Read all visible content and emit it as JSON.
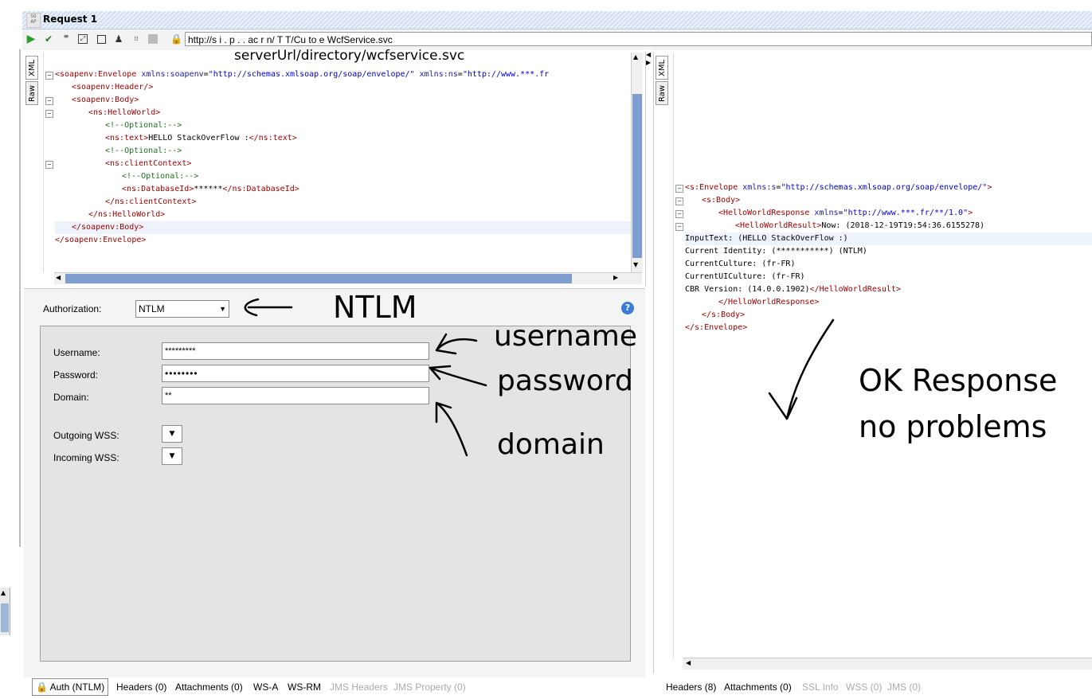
{
  "window": {
    "icon_text": "SO AP",
    "title": "Request 1"
  },
  "toolbar": {
    "url": "http://s      i .  p  .  . ac  r    n/    T  T/Cu  to   e WcfService.svc",
    "icons": [
      "run-icon",
      "validate-icon",
      "sub-icon",
      "expand-icon",
      "square-icon",
      "user-icon",
      "tests-icon",
      "stop-icon",
      "lock-icon"
    ]
  },
  "request": {
    "view_tabs": [
      "XML",
      "Raw"
    ],
    "xml_lines": [
      {
        "indent": 0,
        "fold": true,
        "parts": [
          [
            "tag",
            "<soapenv:Envelope "
          ],
          [
            "attr",
            "xmlns:soapenv"
          ],
          [
            "txt",
            "="
          ],
          [
            "val",
            "\"http://schemas.xmlsoap.org/soap/envelope/\""
          ],
          [
            "txt",
            " "
          ],
          [
            "attr",
            "xmlns:ns"
          ],
          [
            "txt",
            "="
          ],
          [
            "val",
            "\"http://www.***.fr"
          ]
        ]
      },
      {
        "indent": 1,
        "fold": false,
        "parts": [
          [
            "tag",
            "<soapenv:Header/>"
          ]
        ]
      },
      {
        "indent": 1,
        "fold": true,
        "parts": [
          [
            "tag",
            "<soapenv:Body>"
          ]
        ]
      },
      {
        "indent": 2,
        "fold": true,
        "parts": [
          [
            "tag",
            "<ns:HelloWorld>"
          ]
        ]
      },
      {
        "indent": 3,
        "fold": false,
        "parts": [
          [
            "cmt",
            "<!--Optional:-->"
          ]
        ]
      },
      {
        "indent": 3,
        "fold": false,
        "parts": [
          [
            "tag",
            "<ns:text>"
          ],
          [
            "txt",
            "HELLO StackOverFlow :"
          ],
          [
            "tag",
            "</ns:text>"
          ]
        ]
      },
      {
        "indent": 3,
        "fold": false,
        "parts": [
          [
            "cmt",
            "<!--Optional:-->"
          ]
        ]
      },
      {
        "indent": 3,
        "fold": true,
        "parts": [
          [
            "tag",
            "<ns:clientContext>"
          ]
        ]
      },
      {
        "indent": 4,
        "fold": false,
        "parts": [
          [
            "cmt",
            "<!--Optional:-->"
          ]
        ]
      },
      {
        "indent": 4,
        "fold": false,
        "parts": [
          [
            "tag",
            "<ns:DatabaseId>"
          ],
          [
            "txt",
            "******"
          ],
          [
            "tag",
            "</ns:DatabaseId>"
          ]
        ]
      },
      {
        "indent": 3,
        "fold": false,
        "parts": [
          [
            "tag",
            "</ns:clientContext>"
          ]
        ]
      },
      {
        "indent": 2,
        "fold": false,
        "parts": [
          [
            "tag",
            "</ns:HelloWorld>"
          ]
        ]
      },
      {
        "indent": 1,
        "fold": false,
        "parts": [
          [
            "tag",
            "</soapenv:Body>"
          ]
        ]
      },
      {
        "indent": 0,
        "fold": false,
        "parts": [
          [
            "tag",
            "</soapenv:Envelope>"
          ]
        ]
      }
    ],
    "bottom_tabs": [
      {
        "label": "Auth (NTLM)",
        "disabled": false
      },
      {
        "label": "Headers (0)",
        "disabled": false
      },
      {
        "label": "Attachments (0)",
        "disabled": false
      },
      {
        "label": "WS-A",
        "disabled": false
      },
      {
        "label": "WS-RM",
        "disabled": false
      },
      {
        "label": "JMS Headers",
        "disabled": true
      },
      {
        "label": "JMS Property (0)",
        "disabled": true
      }
    ]
  },
  "auth": {
    "authorization_label": "Authorization:",
    "authorization_value": "NTLM",
    "username_label": "Username:",
    "username_value": "*********",
    "password_label": "Password:",
    "password_value": "••••••••",
    "domain_label": "Domain:",
    "domain_value": "**",
    "outgoing_wss_label": "Outgoing WSS:",
    "incoming_wss_label": "Incoming WSS:"
  },
  "response": {
    "view_tabs": [
      "XML",
      "Raw"
    ],
    "xml_lines": [
      {
        "indent": 0,
        "fold": true,
        "parts": [
          [
            "tag",
            "<s:Envelope "
          ],
          [
            "attr",
            "xmlns:s"
          ],
          [
            "txt",
            "="
          ],
          [
            "val",
            "\"http://schemas.xmlsoap.org/soap/envelope/\""
          ],
          [
            "tag",
            ">"
          ]
        ]
      },
      {
        "indent": 1,
        "fold": true,
        "parts": [
          [
            "tag",
            "<s:Body>"
          ]
        ]
      },
      {
        "indent": 2,
        "fold": true,
        "parts": [
          [
            "tag",
            "<HelloWorldResponse "
          ],
          [
            "attr",
            "xmlns"
          ],
          [
            "txt",
            "="
          ],
          [
            "val",
            "\"http://www.***.fr/**/1.0\""
          ],
          [
            "tag",
            ">"
          ]
        ]
      },
      {
        "indent": 3,
        "fold": true,
        "parts": [
          [
            "tag",
            "<HelloWorldResult>"
          ],
          [
            "txt",
            "Now: (2018-12-19T19:54:36.6155278)"
          ]
        ]
      },
      {
        "indent": 0,
        "fold": false,
        "parts": [
          [
            "txt",
            "InputText: (HELLO StackOverFlow :)"
          ]
        ]
      },
      {
        "indent": 0,
        "fold": false,
        "parts": [
          [
            "txt",
            "Current Identity: (***********) (NTLM)"
          ]
        ]
      },
      {
        "indent": 0,
        "fold": false,
        "parts": [
          [
            "txt",
            "CurrentCulture: (fr-FR)"
          ]
        ]
      },
      {
        "indent": 0,
        "fold": false,
        "parts": [
          [
            "txt",
            "CurrentUICulture: (fr-FR)"
          ]
        ]
      },
      {
        "indent": 0,
        "fold": false,
        "parts": [
          [
            "txt",
            "CBR Version: (14.0.0.1902)"
          ],
          [
            "tag",
            "</HelloWorldResult>"
          ]
        ]
      },
      {
        "indent": 2,
        "fold": false,
        "parts": [
          [
            "tag",
            "</HelloWorldResponse>"
          ]
        ]
      },
      {
        "indent": 1,
        "fold": false,
        "parts": [
          [
            "tag",
            "</s:Body>"
          ]
        ]
      },
      {
        "indent": 0,
        "fold": false,
        "parts": [
          [
            "tag",
            "</s:Envelope>"
          ]
        ]
      }
    ],
    "bottom_tabs": [
      {
        "label": "Headers (8)",
        "disabled": false
      },
      {
        "label": "Attachments (0)",
        "disabled": false
      },
      {
        "label": "SSL Info",
        "disabled": true
      },
      {
        "label": "WSS (0)",
        "disabled": true
      },
      {
        "label": "JMS (0)",
        "disabled": true
      }
    ]
  },
  "annotations": {
    "url_note": "serverUrl/directory/wcfservice.svc",
    "ntlm": "NTLM",
    "username": "username",
    "password": "password",
    "domain": "domain",
    "ok_line1": "OK Response",
    "ok_line2": "no problems"
  }
}
